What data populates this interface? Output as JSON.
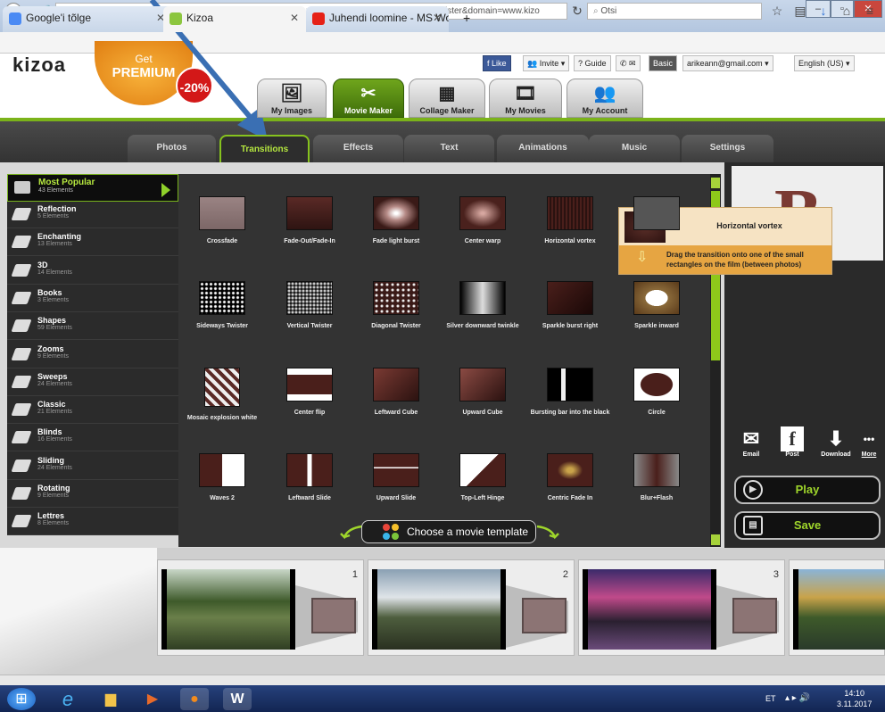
{
  "browser": {
    "tabs": [
      {
        "label": "Google'i tõlge",
        "icon": "google-translate-icon",
        "color": "#4a8af4"
      },
      {
        "label": "Kizoa",
        "icon": "kizoa-icon",
        "color": "#8cc63f"
      },
      {
        "label": "Juhendi loomine - MS Wor...",
        "icon": "youtube-icon",
        "color": "#e62117"
      }
    ],
    "new_tab": "+",
    "url": "https://www.kizoa.com/editor.php?rmode=40&phpsession=&lang=en-us&country=EE&param=register&domain=www.kizo",
    "search_placeholder": "Otsi",
    "window_buttons": [
      "–",
      "▫",
      "✕"
    ]
  },
  "header": {
    "logo": "kizoa",
    "premium_line1": "Get",
    "premium_line2": "PREMIUM",
    "discount": "-20%",
    "like": "Like",
    "invite": "Invite",
    "guide": "Guide",
    "account_type": "Basic",
    "email": "arikeann@gmail.com",
    "language": "English (US)",
    "main_tabs": [
      {
        "label": "My Images",
        "icon": "images-icon",
        "active": false
      },
      {
        "label": "Movie Maker",
        "icon": "movie-maker-icon",
        "active": true
      },
      {
        "label": "Collage Maker",
        "icon": "collage-icon",
        "active": false
      },
      {
        "label": "My Movies",
        "icon": "film-icon",
        "active": false
      },
      {
        "label": "My Account",
        "icon": "account-icon",
        "active": false
      }
    ]
  },
  "subtabs": [
    {
      "label": "Photos",
      "active": false
    },
    {
      "label": "Transitions",
      "active": true
    },
    {
      "label": "Effects",
      "active": false
    },
    {
      "label": "Text",
      "active": false
    },
    {
      "label": "Animations",
      "active": false
    },
    {
      "label": "Music",
      "active": false
    },
    {
      "label": "Settings",
      "active": false
    }
  ],
  "categories": [
    {
      "name": "Most Popular",
      "count": "43 Elements",
      "active": true
    },
    {
      "name": "Reflection",
      "count": "5 Elements"
    },
    {
      "name": "Enchanting",
      "count": "13 Elements"
    },
    {
      "name": "3D",
      "count": "14 Elements"
    },
    {
      "name": "Books",
      "count": "3 Elements"
    },
    {
      "name": "Shapes",
      "count": "59 Elements"
    },
    {
      "name": "Zooms",
      "count": "9 Elements"
    },
    {
      "name": "Sweeps",
      "count": "24 Elements"
    },
    {
      "name": "Classic",
      "count": "21 Elements"
    },
    {
      "name": "Blinds",
      "count": "16 Elements"
    },
    {
      "name": "Sliding",
      "count": "24 Elements"
    },
    {
      "name": "Rotating",
      "count": "9 Elements"
    },
    {
      "name": "Lettres",
      "count": "8 Elements"
    }
  ],
  "transitions": [
    [
      "Crossfade",
      "Fade-Out/Fade-In",
      "Fade light burst",
      "Center warp",
      "Horizontal vortex",
      ""
    ],
    [
      "Sideways Twister",
      "Vertical Twister",
      "Diagonal Twister",
      "Silver downward twinkle",
      "Sparkle burst right",
      "Sparkle inward"
    ],
    [
      "Mosaic explosion white",
      "Center flip",
      "Leftward Cube",
      "Upward Cube",
      "Bursting bar into the black",
      "Circle"
    ],
    [
      "Waves 2",
      "Leftward Slide",
      "Upward Slide",
      "Top-Left Hinge",
      "Centric Fade In",
      "Blur+Flash"
    ]
  ],
  "tooltip": {
    "title": "Horizontal vortex",
    "message": "Drag the transition onto one of the small rectangles on the film (between photos)"
  },
  "preview_letter": "B",
  "share": [
    {
      "label": "Email",
      "icon": "email-icon"
    },
    {
      "label": "Post",
      "icon": "facebook-icon"
    },
    {
      "label": "Download",
      "icon": "download-icon"
    },
    {
      "label": "More",
      "icon": "more-icon"
    }
  ],
  "play_label": "Play",
  "save_label": "Save",
  "template_label": "Choose a movie template",
  "timeline": {
    "frames": [
      "1",
      "2",
      "3"
    ]
  },
  "taskbar": {
    "lang": "ET",
    "time": "14:10",
    "date": "3.11.2017"
  }
}
